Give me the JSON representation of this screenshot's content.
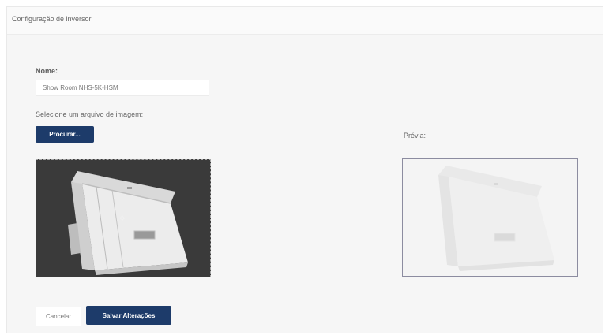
{
  "panel": {
    "title": "Configuração de inversor"
  },
  "form": {
    "name_label": "Nome:",
    "name_value": "Show Room NHS-5K-HSM",
    "file_label": "Selecione um arquivo de imagem:",
    "browse_label": "Procurar...",
    "preview_label": "Prévia:"
  },
  "footer": {
    "cancel_label": "Cancelar",
    "save_label": "Salvar Alterações"
  },
  "colors": {
    "primary": "#1d3b6a",
    "crop_background": "#3a3a3a"
  },
  "icons": {
    "crop_move": "move-arrows-icon"
  }
}
